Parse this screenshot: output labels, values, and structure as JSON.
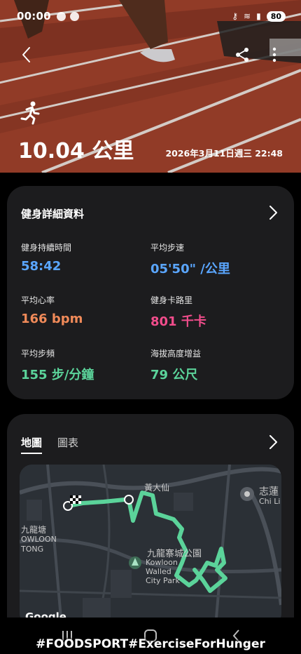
{
  "status_bar": {
    "time": "00:00",
    "battery": "80"
  },
  "hero": {
    "distance": "10.04 公里",
    "datetime": "2026年3月11日週三 22:48"
  },
  "details": {
    "title": "健身詳細資料",
    "stats": [
      {
        "label": "健身持續時間",
        "value": "58:42",
        "color": "#5aa6ff"
      },
      {
        "label": "平均步速",
        "value": "05'50\" /公里",
        "color": "#5aa6ff"
      },
      {
        "label": "平均心率",
        "value": "166 bpm",
        "color": "#f08a59"
      },
      {
        "label": "健身卡路里",
        "value": "801 千卡",
        "color": "#f24d8c"
      },
      {
        "label": "平均步頻",
        "value": "155 步/分鐘",
        "color": "#5bd39a"
      },
      {
        "label": "海拔高度增益",
        "value": "79 公尺",
        "color": "#5bd39a"
      }
    ]
  },
  "map_card": {
    "tabs": [
      {
        "label": "地圖",
        "active": true
      },
      {
        "label": "圖表",
        "active": false
      }
    ],
    "map_labels": {
      "wong_tai_sin": "黃大仙",
      "chi_lin_cn": "志蓮",
      "chi_lin_en": "Chi Li",
      "kowloon_tong_cn": "九龍塘",
      "kowloon_tong_en1": "OWLOON",
      "kowloon_tong_en2": "TONG",
      "park_cn": "九龍寨城公園",
      "park_en1": "Kowloon",
      "park_en2": "Walled",
      "park_en3": "City Park"
    },
    "attribution": "Google",
    "route_color": "#5bd39a"
  },
  "overlay": "#FOODSPORT#ExerciseForHunger",
  "icons": [
    "back-icon",
    "share-icon",
    "more-icon",
    "running-icon",
    "chevron-right-icon",
    "flag-icon",
    "park-icon",
    "temple-icon"
  ]
}
